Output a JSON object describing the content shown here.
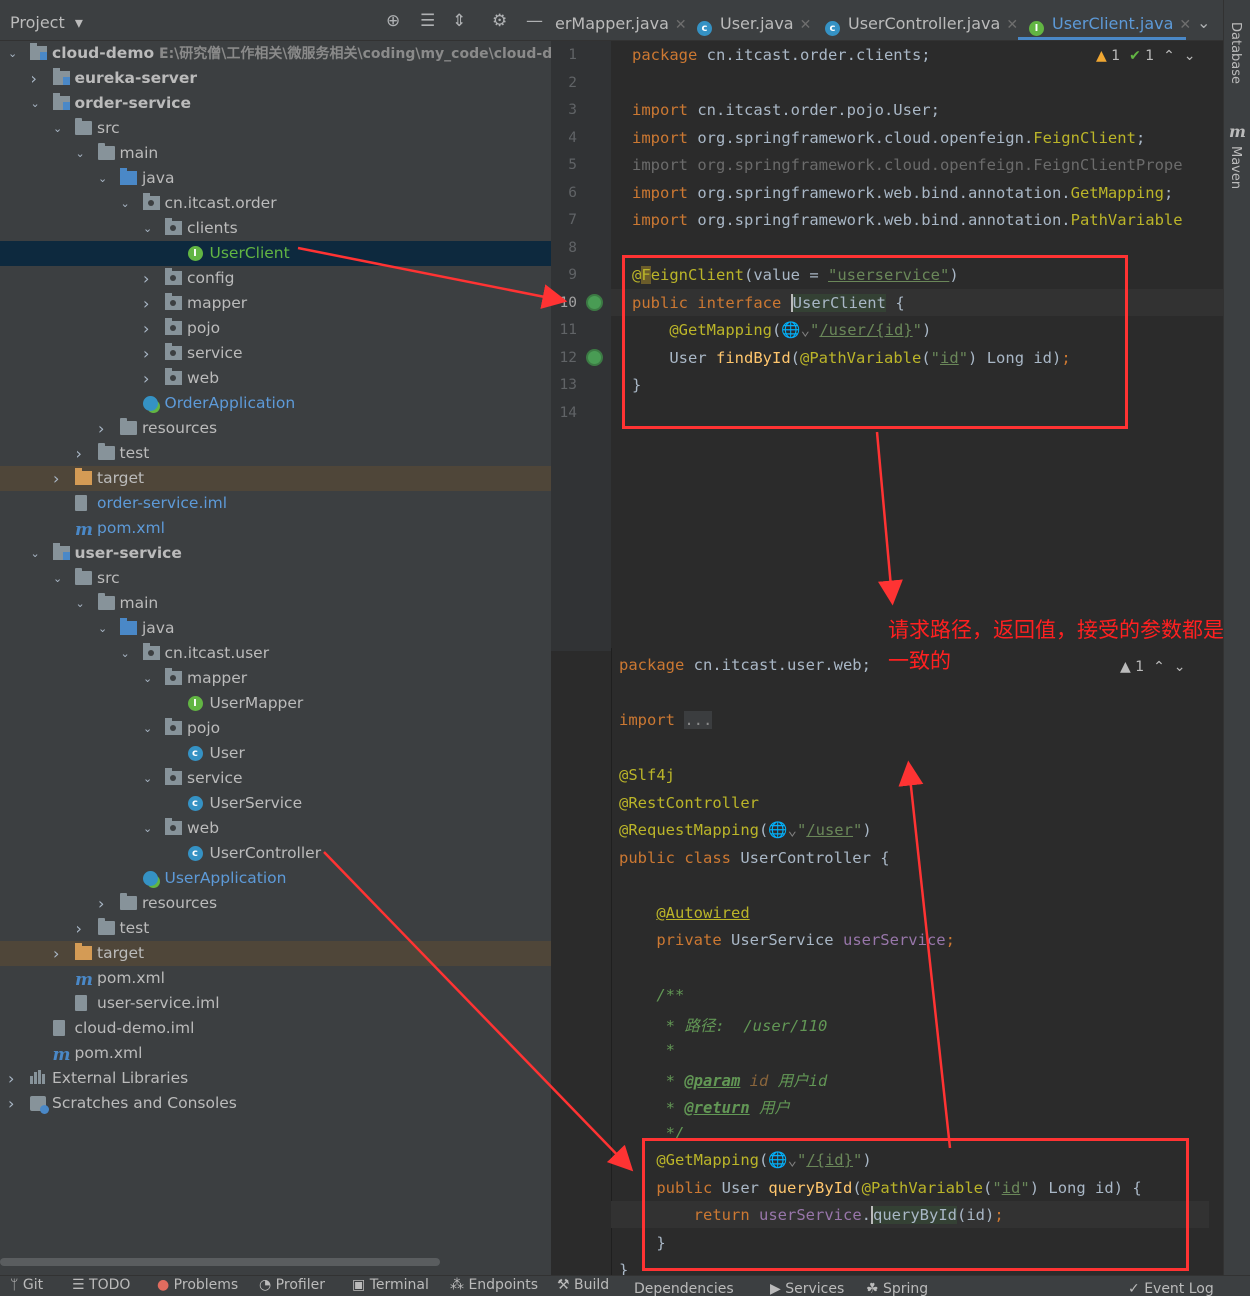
{
  "project_panel": {
    "title": "Project",
    "tree": [
      {
        "label": "cloud-demo",
        "path": "E:\\研究僧\\工作相关\\微服务相关\\coding\\my_code\\cloud-d",
        "type": "module",
        "expanded": true
      },
      {
        "label": "eureka-server",
        "type": "module",
        "expanded": false
      },
      {
        "label": "order-service",
        "type": "module",
        "expanded": true
      },
      {
        "label": "src",
        "type": "folder",
        "expanded": true
      },
      {
        "label": "main",
        "type": "folder",
        "expanded": true
      },
      {
        "label": "java",
        "type": "src",
        "expanded": true
      },
      {
        "label": "cn.itcast.order",
        "type": "package",
        "expanded": true
      },
      {
        "label": "clients",
        "type": "package",
        "expanded": true
      },
      {
        "label": "UserClient",
        "type": "interface",
        "selected": true
      },
      {
        "label": "config",
        "type": "package",
        "expanded": false
      },
      {
        "label": "mapper",
        "type": "package",
        "expanded": false
      },
      {
        "label": "pojo",
        "type": "package",
        "expanded": false
      },
      {
        "label": "service",
        "type": "package",
        "expanded": false
      },
      {
        "label": "web",
        "type": "package",
        "expanded": false
      },
      {
        "label": "OrderApplication",
        "type": "app"
      },
      {
        "label": "resources",
        "type": "folder",
        "expanded": false
      },
      {
        "label": "test",
        "type": "folder",
        "expanded": false
      },
      {
        "label": "target",
        "type": "target",
        "expanded": false
      },
      {
        "label": "order-service.iml",
        "type": "file"
      },
      {
        "label": "pom.xml",
        "type": "maven"
      },
      {
        "label": "user-service",
        "type": "module",
        "expanded": true
      },
      {
        "label": "src",
        "type": "folder",
        "expanded": true
      },
      {
        "label": "main",
        "type": "folder",
        "expanded": true
      },
      {
        "label": "java",
        "type": "src",
        "expanded": true
      },
      {
        "label": "cn.itcast.user",
        "type": "package",
        "expanded": true
      },
      {
        "label": "mapper",
        "type": "package",
        "expanded": true
      },
      {
        "label": "UserMapper",
        "type": "interface"
      },
      {
        "label": "pojo",
        "type": "package",
        "expanded": true
      },
      {
        "label": "User",
        "type": "class"
      },
      {
        "label": "service",
        "type": "package",
        "expanded": true
      },
      {
        "label": "UserService",
        "type": "class"
      },
      {
        "label": "web",
        "type": "package",
        "expanded": true
      },
      {
        "label": "UserController",
        "type": "class"
      },
      {
        "label": "UserApplication",
        "type": "app"
      },
      {
        "label": "resources",
        "type": "folder",
        "expanded": false
      },
      {
        "label": "test",
        "type": "folder",
        "expanded": false
      },
      {
        "label": "target",
        "type": "target",
        "expanded": false
      },
      {
        "label": "pom.xml",
        "type": "maven"
      },
      {
        "label": "user-service.iml",
        "type": "file"
      },
      {
        "label": "cloud-demo.iml",
        "type": "file"
      },
      {
        "label": "pom.xml",
        "type": "maven"
      },
      {
        "label": "External Libraries",
        "type": "lib",
        "expanded": false
      },
      {
        "label": "Scratches and Consoles",
        "type": "scratch",
        "expanded": false
      }
    ]
  },
  "editor_tabs": [
    {
      "label": "erMapper.java",
      "icon": "interface-icon"
    },
    {
      "label": "User.java",
      "icon": "class-icon"
    },
    {
      "label": "UserController.java",
      "icon": "class-icon"
    },
    {
      "label": "UserClient.java",
      "icon": "interface-icon",
      "active": true
    }
  ],
  "editor_main": {
    "inspection": {
      "warnings": "1",
      "ok": "1"
    },
    "line_numbers": [
      "1",
      "2",
      "3",
      "4",
      "5",
      "6",
      "7",
      "8",
      "9",
      "10",
      "11",
      "12",
      "13",
      "14"
    ]
  },
  "editor_secondary": {
    "inspection": {
      "warnings": "1"
    }
  },
  "annotation_note": "请求路径，返回值，接受的参数都是一致的",
  "right_tools": {
    "database": "Database",
    "maven": "Maven"
  },
  "status_bar": [
    "Git",
    "TODO",
    "Problems",
    "Profiler",
    "Terminal",
    "Endpoints",
    "Build",
    "Dependencies",
    "Services",
    "Spring",
    "Event Log"
  ],
  "colors": {
    "accent": "#4a88c7",
    "annotation_red": "#ff3333",
    "keyword": "#cc7832",
    "annotation": "#bbb529",
    "string": "#6a8759"
  }
}
